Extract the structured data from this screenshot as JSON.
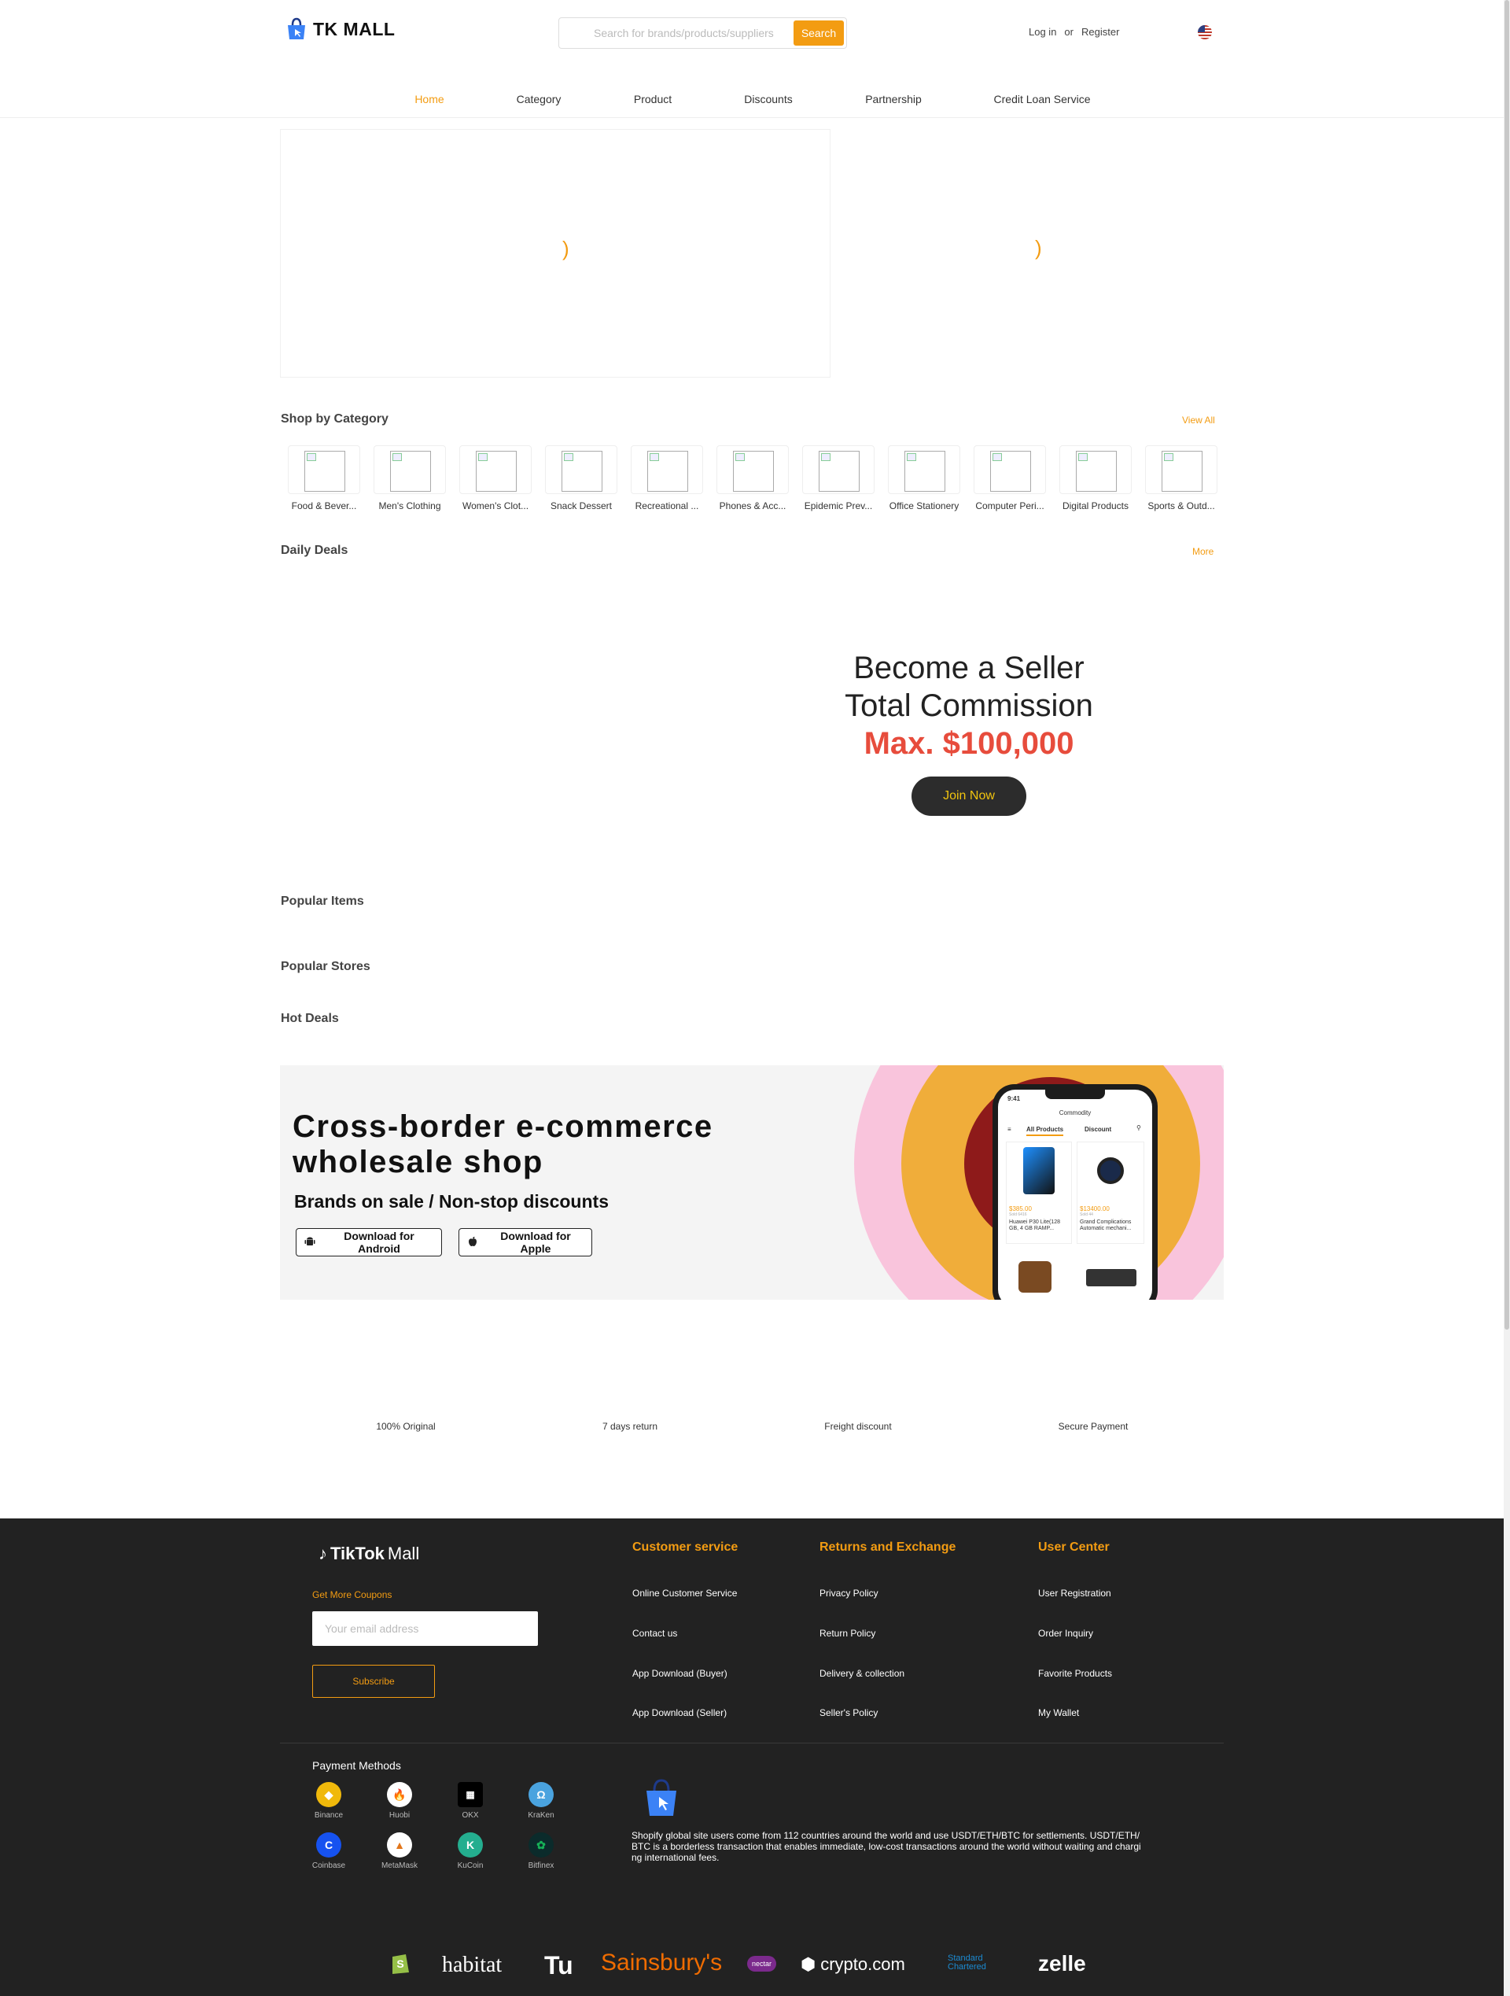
{
  "header": {
    "logo_text": "TK MALL",
    "search_placeholder": "Search for brands/products/suppliers",
    "search_button": "Search",
    "login": "Log in",
    "or": "or",
    "register": "Register"
  },
  "nav": [
    "Home",
    "Category",
    "Product",
    "Discounts",
    "Partnership",
    "Credit Loan Service"
  ],
  "shop_by_category": {
    "title": "Shop by Category",
    "view_all": "View All",
    "items": [
      "Food & Bever...",
      "Men's Clothing",
      "Women's Clot...",
      "Snack Dessert",
      "Recreational ...",
      "Phones & Acc...",
      "Epidemic Prev...",
      "Office Stationery",
      "Computer Peri...",
      "Digital Products",
      "Sports & Outd..."
    ]
  },
  "daily_deals": {
    "title": "Daily Deals",
    "more": "More"
  },
  "seller_promo": {
    "line1": "Become a Seller",
    "line2": "Total Commission",
    "line3": "Max. $100,000",
    "button": "Join Now"
  },
  "sections": {
    "popular_items": "Popular Items",
    "popular_stores": "Popular Stores",
    "hot_deals": "Hot Deals"
  },
  "cross_border": {
    "title_line1": "Cross-border e-commerce",
    "title_line2": "wholesale shop",
    "subtitle": "Brands on sale / Non-stop discounts",
    "android": "Download for Android",
    "apple": "Download for Apple",
    "phone": {
      "time": "9:41",
      "header": "Commodity",
      "tab_all": "All Products",
      "tab_discount": "Discount",
      "p1_price": "$385.00",
      "p1_sold": "Sold 6416",
      "p1_name": "Huawei P30 Lite(128 GB, 4 GB RAMP...",
      "p2_price": "$13400.00",
      "p2_sold": "Sold 44",
      "p2_name": "Grand Complications Automatic mechani..."
    }
  },
  "features": [
    "100% Original",
    "7 days return",
    "Freight discount",
    "Secure Payment"
  ],
  "footer": {
    "logo_tiktok": "TikTok",
    "logo_mall": "Mall",
    "coupon_label": "Get More Coupons",
    "email_placeholder": "Your email address",
    "subscribe": "Subscribe",
    "columns": [
      {
        "title": "Customer service",
        "links": [
          "Online Customer Service",
          "Contact us",
          "App Download (Buyer)",
          "App Download (Seller)"
        ]
      },
      {
        "title": "Returns and Exchange",
        "links": [
          "Privacy Policy",
          "Return Policy",
          "Delivery & collection",
          "Seller's Policy"
        ]
      },
      {
        "title": "User Center",
        "links": [
          "User Registration",
          "Order Inquiry",
          "Favorite Products",
          "My Wallet"
        ]
      }
    ],
    "payment_title": "Payment Methods",
    "payments": [
      "Binance",
      "Huobi",
      "OKX",
      "KraKen",
      "Coinbase",
      "MetaMask",
      "KuCoin",
      "Bitfinex"
    ],
    "description": "Shopify global site users come from 112 countries around the world and use USDT/ETH/BTC for settlements. USDT/ETH/BTC is a borderless transaction that enables immediate, low-cost transactions around the world without waiting and charging international fees.",
    "brands": [
      "habitat",
      "Tu",
      "Sainsbury's",
      "nectar",
      "crypto.com",
      "Standard Chartered",
      "zelle"
    ]
  }
}
